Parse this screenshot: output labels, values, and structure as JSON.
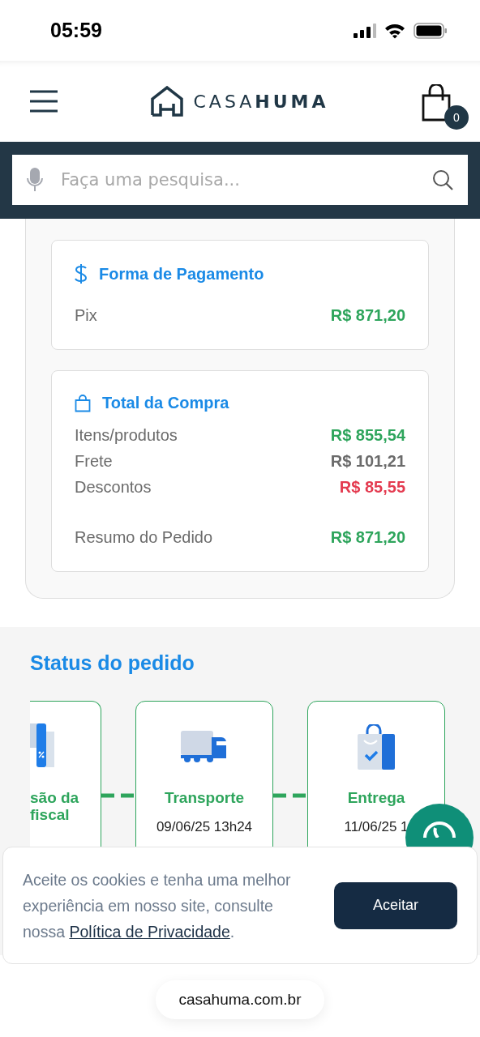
{
  "status_bar": {
    "time": "05:59"
  },
  "header": {
    "logo": {
      "light": "CASA",
      "bold": "HUMA"
    },
    "cart_count": "0"
  },
  "search": {
    "placeholder": "Faça uma pesquisa..."
  },
  "payment": {
    "title": "Forma de Pagamento",
    "rows": [
      {
        "label": "Pix",
        "value": "R$ 871,20",
        "color": "#2ea55c"
      }
    ]
  },
  "total": {
    "title": "Total da Compra",
    "rows": [
      {
        "label": "Itens/produtos",
        "value": "R$ 855,54",
        "color": "#2ea55c"
      },
      {
        "label": "Frete",
        "value": "R$ 101,21",
        "color": "#6b6b6b"
      },
      {
        "label": "Descontos",
        "value": "R$ 85,55",
        "color": "#e43b50"
      }
    ],
    "summary": {
      "label": "Resumo do Pedido",
      "value": "R$ 871,20",
      "color": "#2ea55c"
    }
  },
  "order_status": {
    "title": "Status do pedido",
    "steps": [
      {
        "kind": "invoice",
        "partial": true,
        "title": "são da fiscal"
      },
      {
        "kind": "truck",
        "partial": false,
        "title": "Transporte",
        "date": "09/06/25 13h24"
      },
      {
        "kind": "bag",
        "partial": false,
        "title": "Entrega",
        "date": "11/06/25 1"
      }
    ]
  },
  "cookie_banner": {
    "text_before": "Aceite os cookies e tenha uma melhor experiência em nosso site, consulte nossa ",
    "link": "Política de Privacidade",
    "text_after": ".",
    "button": "Aceitar"
  },
  "url_bar": {
    "url": "casahuma.com.br"
  }
}
